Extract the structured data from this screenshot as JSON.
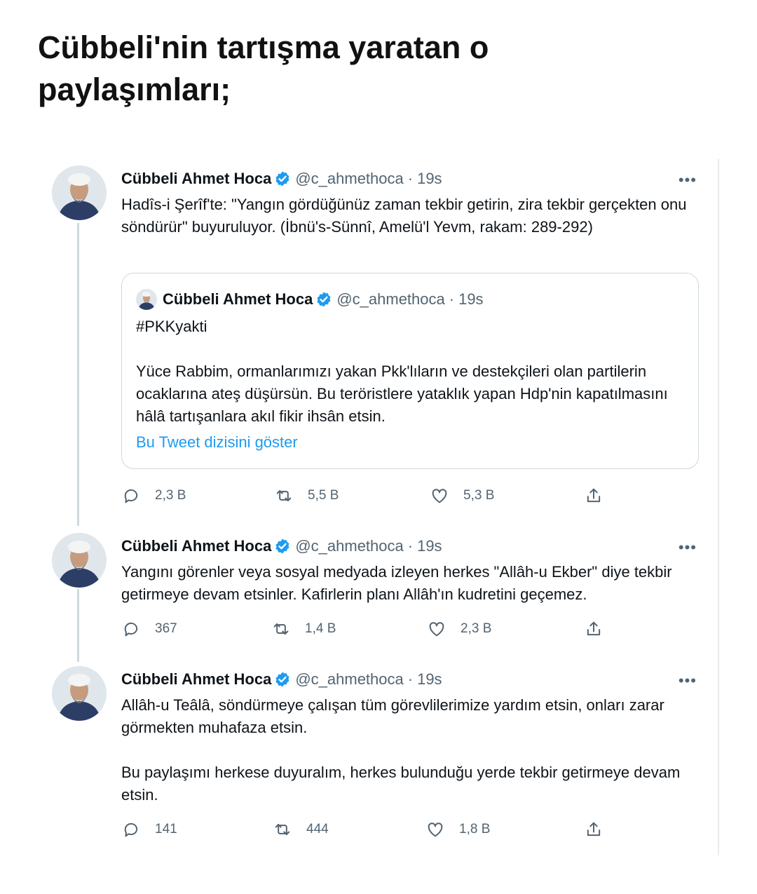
{
  "headline": "Cübbeli'nin tartışma yaratan o paylaşımları;",
  "tweets": [
    {
      "name": "Cübbeli Ahmet Hoca",
      "handle": "@c_ahmethoca",
      "separator": "·",
      "time": "19s",
      "more": "•••",
      "text": "Hadîs-i Şerîf'te: \"Yangın gördüğünüz zaman tekbir getirin, zira tekbir gerçekten onu söndürür\" buyuruluyor. (İbnü's-Sünnî, Amelü'l Yevm, rakam: 289-292)",
      "quote": {
        "name": "Cübbeli Ahmet Hoca",
        "handle": "@c_ahmethoca",
        "separator": "·",
        "time": "19s",
        "hashtag": "#PKKyakti",
        "text": "Yüce Rabbim, ormanlarımızı yakan Pkk'lıların ve destekçileri olan partilerin ocaklarına ateş düşürsün. Bu teröristlere yataklık yapan Hdp'nin kapatılmasını hâlâ tartışanlara akıl fikir ihsân etsin.",
        "link": "Bu Tweet dizisini göster"
      },
      "replies": "2,3 B",
      "retweets": "5,5 B",
      "likes": "5,3 B"
    },
    {
      "name": "Cübbeli Ahmet Hoca",
      "handle": "@c_ahmethoca",
      "separator": "·",
      "time": "19s",
      "more": "•••",
      "text": "Yangını görenler veya sosyal medyada izleyen herkes \"Allâh-u Ekber\" diye tekbir getirmeye devam etsinler. Kafirlerin planı Allâh'ın kudretini geçemez.",
      "replies": "367",
      "retweets": "1,4 B",
      "likes": "2,3 B"
    },
    {
      "name": "Cübbeli Ahmet Hoca",
      "handle": "@c_ahmethoca",
      "separator": "·",
      "time": "19s",
      "more": "•••",
      "text": "Allâh-u Teâlâ, söndürmeye çalışan tüm görevlilerimize yardım etsin, onları zarar görmekten muhafaza etsin.",
      "text2": "Bu paylaşımı herkese duyuralım, herkes bulunduğu yerde tekbir getirmeye devam etsin.",
      "replies": "141",
      "retweets": "444",
      "likes": "1,8 B"
    }
  ],
  "colors": {
    "verified": "#1d9bf0",
    "link": "#1d9bf0",
    "muted": "#536471",
    "thread_line": "#cfd9de"
  },
  "icons": [
    "verified-badge-icon",
    "more-icon",
    "reply-icon",
    "retweet-icon",
    "like-icon",
    "share-icon"
  ]
}
